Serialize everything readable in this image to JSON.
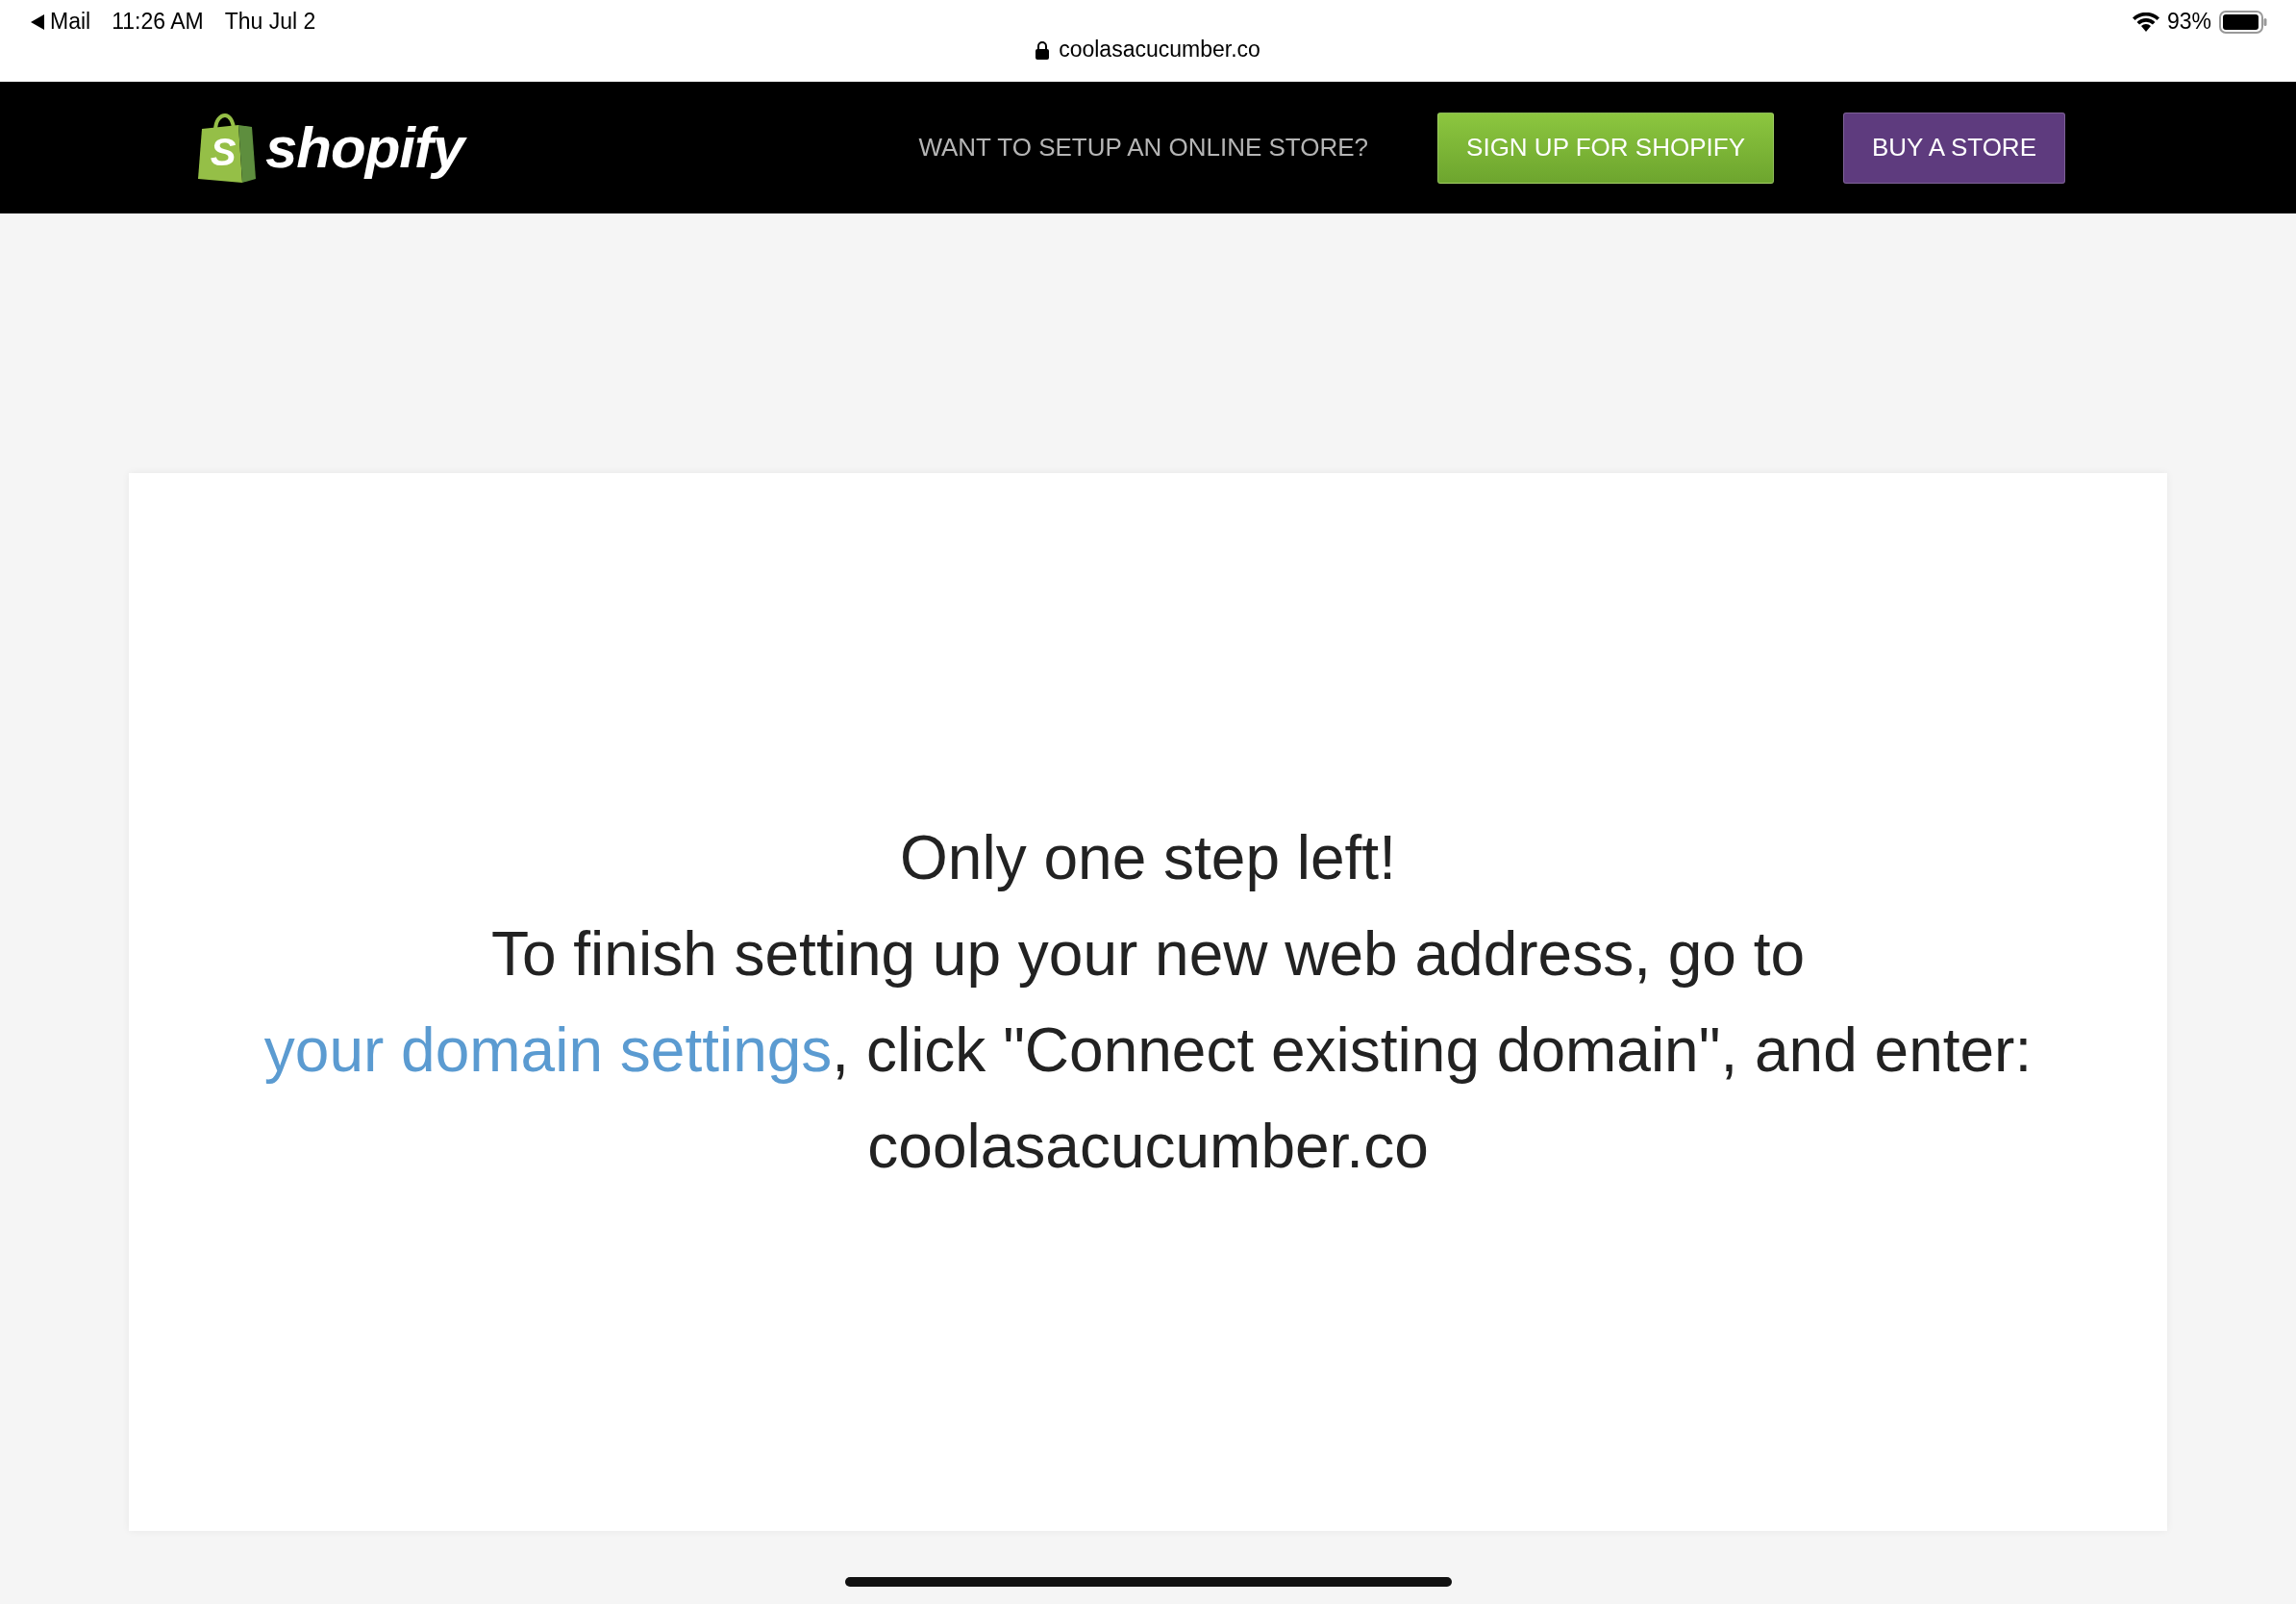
{
  "status_bar": {
    "back_app": "Mail",
    "time": "11:26 AM",
    "date": "Thu Jul 2",
    "url": "coolasacucumber.co",
    "battery": "93%"
  },
  "header": {
    "logo_mark": "S",
    "logo": "shopify",
    "tagline": "WANT TO SETUP AN ONLINE STORE?",
    "buttons": [
      {
        "label": "SIGN UP FOR SHOPIFY",
        "kind": "primary"
      },
      {
        "label": "BUY A STORE",
        "kind": "secondary"
      }
    ]
  },
  "message": {
    "heading": "Only one step left!",
    "text_before": "To finish setting up your new web address, go to ",
    "link": "your domain settings",
    "text_after": ", click \"Connect existing domain\", and enter:",
    "domain": "coolasacucumber.co"
  }
}
